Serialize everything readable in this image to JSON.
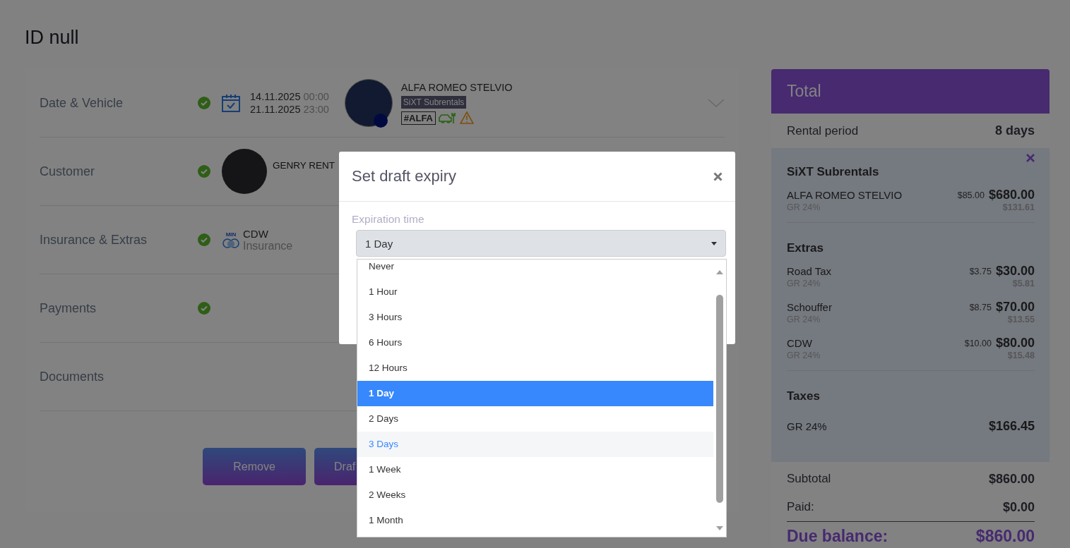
{
  "page": {
    "title": "ID null"
  },
  "sections": [
    {
      "kind": "vehicle",
      "label": "Date & Vehicle",
      "complete": true,
      "dates": [
        {
          "date": "14.11.2025",
          "time": "00:00"
        },
        {
          "date": "21.11.2025",
          "time": "23:00"
        }
      ],
      "vehicle": "ALFA ROMEO STELVIO",
      "supplier": "SiXT Subrentals",
      "plate": "#ALFA",
      "expanded": false
    },
    {
      "kind": "customer",
      "label": "Customer",
      "complete": true,
      "name": "GENRY RENT"
    },
    {
      "kind": "insurance",
      "label": "Insurance & Extras",
      "complete": true,
      "badge": "MIN",
      "name": "CDW",
      "sub": "Insurance"
    },
    {
      "kind": "plain",
      "label": "Payments",
      "complete": true
    },
    {
      "kind": "plain",
      "label": "Documents",
      "complete": false
    }
  ],
  "buttons": [
    "Remove",
    "Draf"
  ],
  "summary": {
    "title": "Total",
    "period_label": "Rental period",
    "period_value": "8 days",
    "groups": [
      {
        "title": "SiXT Subrentals",
        "removable": true,
        "items": [
          {
            "name": "ALFA ROMEO STELVIO",
            "tax": "GR 24%",
            "unit": "$85.00",
            "total": "$680.00",
            "tax_amount": "$131.61"
          }
        ]
      },
      {
        "title": "Extras",
        "removable": false,
        "items": [
          {
            "name": "Road Tax",
            "tax": "GR 24%",
            "unit": "$3.75",
            "total": "$30.00",
            "tax_amount": "$5.81"
          },
          {
            "name": "Schouffer",
            "tax": "GR 24%",
            "unit": "$8.75",
            "total": "$70.00",
            "tax_amount": "$13.55"
          },
          {
            "name": "CDW",
            "tax": "GR 24%",
            "unit": "$10.00",
            "total": "$80.00",
            "tax_amount": "$15.48"
          }
        ]
      }
    ],
    "taxes_title": "Taxes",
    "taxes": [
      {
        "name": "GR 24%",
        "amount": "$166.45"
      }
    ],
    "subtotal_label": "Subtotal",
    "subtotal": "$860.00",
    "paid_label": "Paid:",
    "paid": "$0.00",
    "due_label": "Due balance:",
    "due": "$860.00"
  },
  "modal": {
    "title": "Set draft expiry",
    "field_label": "Expiration time",
    "value": "1 Day",
    "options": [
      {
        "label": "Never",
        "selected": false,
        "hovered": false
      },
      {
        "label": "1 Hour",
        "selected": false,
        "hovered": false
      },
      {
        "label": "3 Hours",
        "selected": false,
        "hovered": false
      },
      {
        "label": "6 Hours",
        "selected": false,
        "hovered": false
      },
      {
        "label": "12 Hours",
        "selected": false,
        "hovered": false
      },
      {
        "label": "1 Day",
        "selected": true,
        "hovered": false
      },
      {
        "label": "2 Days",
        "selected": false,
        "hovered": false
      },
      {
        "label": "3 Days",
        "selected": false,
        "hovered": true
      },
      {
        "label": "1 Week",
        "selected": false,
        "hovered": false
      },
      {
        "label": "2 Weeks",
        "selected": false,
        "hovered": false
      },
      {
        "label": "1 Month",
        "selected": false,
        "hovered": false
      }
    ]
  }
}
